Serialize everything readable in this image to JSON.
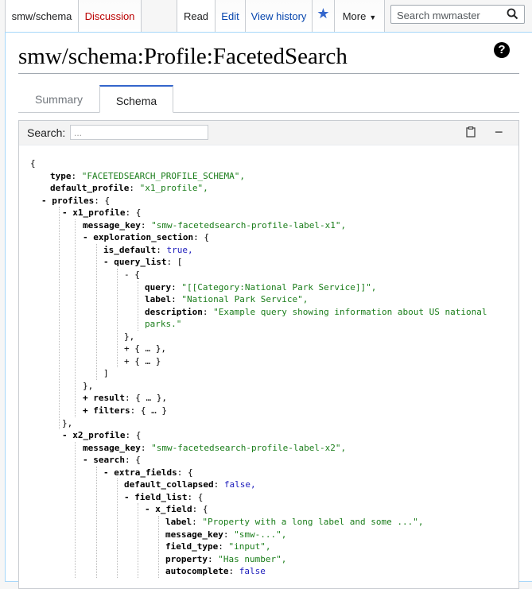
{
  "tabs": {
    "namespace": "smw/schema",
    "discussion": "Discussion",
    "read": "Read",
    "edit": "Edit",
    "history": "View history",
    "star": "★",
    "more": "More",
    "more_arrow": "▼"
  },
  "search": {
    "placeholder": "Search mwmaster"
  },
  "page": {
    "title": "smw/schema:Profile:FacetedSearch",
    "help": "?"
  },
  "subtabs": {
    "summary": "Summary",
    "schema": "Schema"
  },
  "panel": {
    "search_label": "Search:",
    "search_placeholder": "...",
    "collapse": "−"
  },
  "colors": {
    "link": "#0645ad",
    "new_link": "#ba0000",
    "string": "#1a7d1a",
    "keyword": "#1b1bbb",
    "accent": "#3366cc"
  },
  "lines": [
    {
      "t": "{"
    },
    {
      "t": "type",
      "v": "\"FACETEDSEARCH_PROFILE_SCHEMA\",",
      "c": "s"
    },
    {
      "t": "default_profile",
      "v": "\"x1_profile\",",
      "c": "s"
    },
    {
      "t": "- profiles",
      "v": "{",
      "c": ""
    },
    {
      "t": "- x1_profile",
      "v": "{",
      "c": ""
    },
    {
      "t": "message_key",
      "v": "\"smw-facetedsearch-profile-label-x1\",",
      "c": "s"
    },
    {
      "t": "- exploration_section",
      "v": "{",
      "c": ""
    },
    {
      "t": "is_default",
      "v": "true,",
      "c": "n"
    },
    {
      "t": "- query_list",
      "v": "[",
      "c": ""
    },
    {
      "t": "- {"
    },
    {
      "t": "query",
      "v": "\"[[Category:National Park Service]]\",",
      "c": "s"
    },
    {
      "t": "label",
      "v": "\"National Park Service\",",
      "c": "s"
    },
    {
      "t": "description",
      "v": "\"Example query showing information about US national",
      "c": "s"
    },
    {
      "t": "",
      "v": "parks.\"",
      "c": "s"
    },
    {
      "t": "},"
    },
    {
      "t": "+ { … },"
    },
    {
      "t": "+ { … }"
    },
    {
      "t": "]"
    },
    {
      "t": "},"
    },
    {
      "t": "+ result",
      "v": "{ … },",
      "c": ""
    },
    {
      "t": "+ filters",
      "v": "{ … }",
      "c": ""
    },
    {
      "t": "},"
    },
    {
      "t": "- x2_profile",
      "v": "{",
      "c": ""
    },
    {
      "t": "message_key",
      "v": "\"smw-facetedsearch-profile-label-x2\",",
      "c": "s"
    },
    {
      "t": "- search",
      "v": "{",
      "c": ""
    },
    {
      "t": "- extra_fields",
      "v": "{",
      "c": ""
    },
    {
      "t": "default_collapsed",
      "v": "false,",
      "c": "n"
    },
    {
      "t": "- field_list",
      "v": "{",
      "c": ""
    },
    {
      "t": "- x_field",
      "v": "{",
      "c": ""
    },
    {
      "t": "label",
      "v": "\"Property with a long label and some ...\",",
      "c": "s"
    },
    {
      "t": "message_key",
      "v": "\"smw-...\",",
      "c": "s"
    },
    {
      "t": "field_type",
      "v": "\"input\",",
      "c": "s"
    },
    {
      "t": "property",
      "v": "\"Has number\",",
      "c": "s"
    },
    {
      "t": "autocomplete",
      "v": "false",
      "c": "n"
    }
  ]
}
